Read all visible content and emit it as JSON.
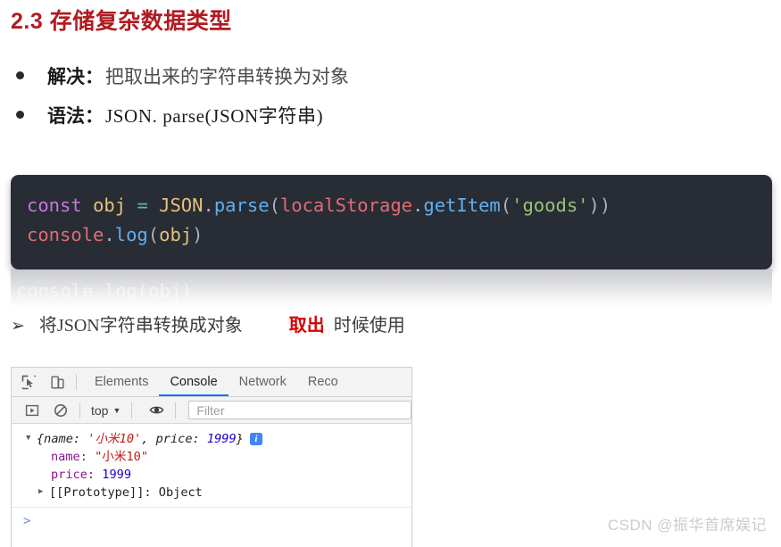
{
  "title": "2.3 存储复杂数据类型",
  "title_color": "#b01c22",
  "bullets": [
    {
      "label": "解决：",
      "text": "把取出来的字符串转换为对象",
      "bullet_icon": "filled-dot"
    },
    {
      "label": "语法：",
      "text": "JSON. parse(JSON字符串)",
      "bullet_icon": "filled-dot"
    }
  ],
  "code_block": {
    "theme_background": "#282c34",
    "lines": [
      [
        {
          "t": "const",
          "c": "tk-kw"
        },
        {
          "t": " ",
          "c": "tk-punc"
        },
        {
          "t": "obj",
          "c": "tk-var"
        },
        {
          "t": " ",
          "c": "tk-punc"
        },
        {
          "t": "=",
          "c": "tk-op"
        },
        {
          "t": " ",
          "c": "tk-punc"
        },
        {
          "t": "JSON",
          "c": "tk-var"
        },
        {
          "t": ".",
          "c": "tk-punc"
        },
        {
          "t": "parse",
          "c": "tk-fn"
        },
        {
          "t": "(",
          "c": "tk-punc"
        },
        {
          "t": "localStorage",
          "c": "tk-obj"
        },
        {
          "t": ".",
          "c": "tk-punc"
        },
        {
          "t": "getItem",
          "c": "tk-fn"
        },
        {
          "t": "(",
          "c": "tk-punc"
        },
        {
          "t": "'goods'",
          "c": "tk-str"
        },
        {
          "t": "))",
          "c": "tk-punc"
        }
      ],
      [
        {
          "t": "console",
          "c": "tk-obj"
        },
        {
          "t": ".",
          "c": "tk-punc"
        },
        {
          "t": "log",
          "c": "tk-fn"
        },
        {
          "t": "(",
          "c": "tk-punc"
        },
        {
          "t": "obj",
          "c": "tk-var"
        },
        {
          "t": ")",
          "c": "tk-punc"
        }
      ]
    ],
    "ghost_text": "console.log(obj)"
  },
  "arrow_line": {
    "marker": "➢",
    "text": "将JSON字符串转换成对象",
    "emphasis": "取出",
    "emphasis_color": "#d80000",
    "tail": "时候使用"
  },
  "devtools": {
    "icons": {
      "inspect": "inspect-element-icon",
      "device": "device-toolbar-icon",
      "execute": "execute-icon",
      "clear": "clear-console-icon",
      "eye": "eye-icon"
    },
    "tabs": [
      {
        "label": "Elements",
        "active": false
      },
      {
        "label": "Console",
        "active": true
      },
      {
        "label": "Network",
        "active": false
      },
      {
        "label": "Reco",
        "active": false
      }
    ],
    "active_tab_underline_color": "#1a73e8",
    "toolbar": {
      "context": "top",
      "caret": "▼",
      "filter_placeholder": "Filter"
    },
    "console": {
      "summary": {
        "triangle": "▼",
        "open_brace": "{name: ",
        "name_value": "'小米10'",
        "mid": ", price: ",
        "price_value": "1999",
        "close_brace": "}",
        "info_badge": "i"
      },
      "properties": [
        {
          "key": "name:",
          "value": "\"小米10\"",
          "value_type": "string"
        },
        {
          "key": "price:",
          "value": "1999",
          "value_type": "number"
        }
      ],
      "prototype": {
        "triangle": "▶",
        "text": "[[Prototype]]: Object"
      },
      "prompt_arrow": ">"
    }
  },
  "watermark": "CSDN @振华首席娱记"
}
